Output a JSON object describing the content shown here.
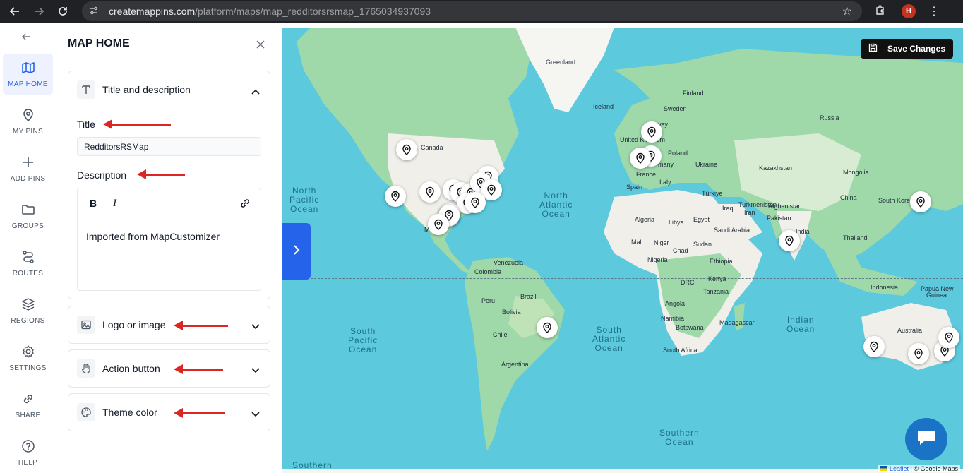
{
  "browser": {
    "url_host": "createmappins.com",
    "url_path": "/platform/maps/map_redditorsrsmap_1765034937093",
    "profile_initial": "H"
  },
  "rail": {
    "items": [
      {
        "label": "MAP HOME",
        "icon": "map-icon",
        "active": true
      },
      {
        "label": "MY PINS",
        "icon": "pin-icon"
      },
      {
        "label": "ADD PINS",
        "icon": "plus-icon"
      },
      {
        "label": "GROUPS",
        "icon": "folder-icon"
      },
      {
        "label": "ROUTES",
        "icon": "route-icon"
      },
      {
        "label": "REGIONS",
        "icon": "layers-icon"
      },
      {
        "label": "SETTINGS",
        "icon": "gear-icon"
      },
      {
        "label": "SHARE",
        "icon": "link-icon"
      },
      {
        "label": "HELP",
        "icon": "help-icon"
      }
    ]
  },
  "panel": {
    "title": "MAP HOME",
    "sections": {
      "title_desc": "Title and description",
      "logo": "Logo or image",
      "action": "Action button",
      "theme": "Theme color"
    },
    "title_label": "Title",
    "title_value": "RedditorsRSMap",
    "description_label": "Description",
    "description_text": "Imported from MapCustomizer",
    "toolbar": {
      "bold": "B",
      "italic": "I"
    }
  },
  "map": {
    "save_label": "Save Changes",
    "attribution_leaflet": "Leaflet",
    "attribution_rest": " | © Google Maps",
    "countries": {
      "greenland": "Greenland",
      "iceland": "Iceland",
      "finland": "Finland",
      "sweden": "Sweden",
      "russia": "Russia",
      "norway": "way",
      "united_kingdom": "United Kingdom",
      "poland": "Poland",
      "germany": "many",
      "ukraine": "Ukraine",
      "france": "France",
      "kazakhstan": "Kazakhstan",
      "mongolia": "Mongolia",
      "spain": "Spain",
      "italy": "Italy",
      "turkiye": "Türkiye",
      "turkmenistan": "Turkmenistan",
      "china": "China",
      "south_korea": "South Kore",
      "iraq": "Iraq",
      "iran": "Iran",
      "afghanistan": "Afghanistan",
      "pakistan": "Pakistan",
      "algeria": "Algeria",
      "libya": "Libya",
      "egypt": "Egypt",
      "saudi_arabia": "Saudi Arabia",
      "india": "India",
      "thailand": "Thailand",
      "mali": "Mali",
      "niger": "Niger",
      "chad": "Chad",
      "sudan": "Sudan",
      "nigeria": "Nigeria",
      "ethiopia": "Ethiopia",
      "drc": "DRC",
      "kenya": "Kenya",
      "tanzania": "Tanzania",
      "indonesia": "Indonesia",
      "papua_new_guinea_1": "Papua New",
      "papua_new_guinea_2": "Guinea",
      "angola": "Angola",
      "namibia": "Namibia",
      "botswana": "Botswana",
      "madagascar": "Madagascar",
      "south_africa": "South Africa",
      "australia": "Australia",
      "canada": "Canada",
      "venezuela": "Venezuela",
      "colombia": "Colombia",
      "peru": "Peru",
      "brazil": "Brazil",
      "bolivia": "Bolivia",
      "chile": "Chile",
      "argentina": "Argentina",
      "mexico": "M"
    },
    "oceans": {
      "north_pacific": [
        "North",
        "Pacific",
        "Ocean"
      ],
      "north_atlantic": [
        "North",
        "Atlantic",
        "Ocean"
      ],
      "south_pacific": [
        "South",
        "Pacific",
        "Ocean"
      ],
      "south_atlantic": [
        "South",
        "Atlantic",
        "Ocean"
      ],
      "indian": [
        "Indian",
        "Ocean"
      ],
      "southern": [
        "Southern",
        "Ocean"
      ],
      "southern_partial": "Southern"
    }
  }
}
